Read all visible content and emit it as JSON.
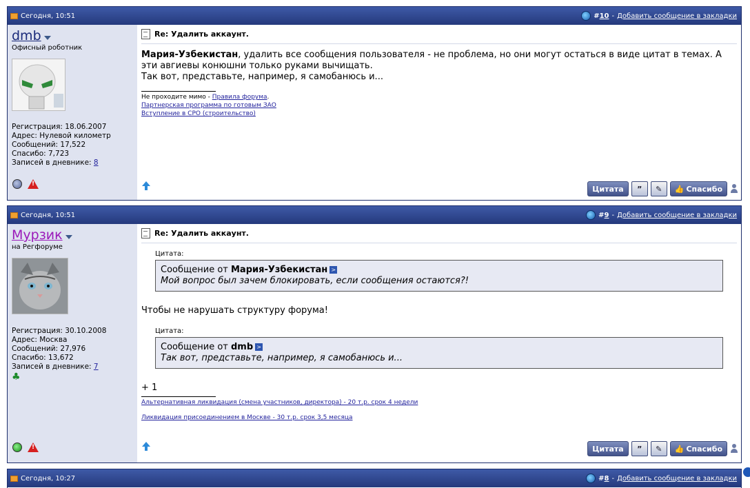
{
  "posts": [
    {
      "date": "Сегодня, 10:51",
      "number_prefix": "#",
      "number": "10",
      "bookmark_sep": " - ",
      "bookmark": "Добавить сообщение в закладки",
      "username": "dmb",
      "user_title": "Офисный роботник",
      "reg": "Регистрация: 18.06.2007",
      "addr": "Адрес: Нулевой километр",
      "msgs": "Сообщений: 17,522",
      "thanks": "Спасибо: 7,723",
      "diary_label": "Записей в дневнике: ",
      "diary_count": "8",
      "title": "Re: Удалить аккаунт.",
      "msg_bold": "Мария-Узбекистан",
      "msg_rest": ", удалить все сообщения пользователя - не проблема, но они могут остаться в виде цитат в темах. А эти авгиевы конюшни только руками вычищать.",
      "msg_line2": "Так вот, представьте, например, я самобанюсь и...",
      "sig_text": "Не проходите мимо - ",
      "sig_link1": "Правила форума",
      "sig_dot": ".",
      "sig_link2": "Партнерская программа по готовым ЗАО",
      "sig_link3": "Вступление в СРО (строительство)"
    },
    {
      "date": "Сегодня, 10:51",
      "number_prefix": "#",
      "number": "9",
      "bookmark_sep": " - ",
      "bookmark": "Добавить сообщение в закладки",
      "username": "Мурзик",
      "user_title": "на Регфоруме",
      "reg": "Регистрация: 30.10.2008",
      "addr": "Адрес: Москва",
      "msgs": "Сообщений: 27,976",
      "thanks": "Спасибо: 13,672",
      "diary_label": "Записей в дневнике: ",
      "diary_count": "7",
      "title": "Re: Удалить аккаунт.",
      "quote_label": "Цитата:",
      "quote1_from_prefix": "Сообщение от ",
      "quote1_author": "Мария-Узбекистан",
      "quote1_text": "Мой вопрос был зачем блокировать, если сообщения остаются?!",
      "reply_text": "Чтобы не нарушать структуру форума!",
      "quote2_from_prefix": "Сообщение от ",
      "quote2_author": "dmb",
      "quote2_text": "Так вот, представьте, например, я самобанюсь и...",
      "plus_text": "+ 1",
      "sig_link1": "Альтернативная ликвидация (смена участников, директора) - 20 т.р. срок 4 недели",
      "sig_link2": "Ликвидация присоединением в Москве - 30 т.р. срок 3,5 месяца"
    },
    {
      "date": "Сегодня, 10:27",
      "number_prefix": "#",
      "number": "8",
      "bookmark_sep": " - ",
      "bookmark": "Добавить сообщение в закладки"
    }
  ],
  "buttons": {
    "quote": "Цитата",
    "multiquote_icon": "multiquote-icon",
    "edit_icon": "edit-icon",
    "thanks": "Спасибо",
    "thanks_icon": "thumbs-up-icon"
  },
  "icons": {
    "post_folder": "folder-icon",
    "bookmark": "globe-icon",
    "title_doc": "document-icon",
    "up": "up-arrow-icon",
    "warn": "warning-icon",
    "clover": "clover-icon"
  },
  "colors": {
    "header_bg": "#2f4790",
    "user_col_bg": "#dfe3f0",
    "dmb_name": "#1a2a7a",
    "murzik_name": "#9b1aba",
    "offline_dot": "#6d7fae",
    "online_dot": "#1ea81e"
  }
}
